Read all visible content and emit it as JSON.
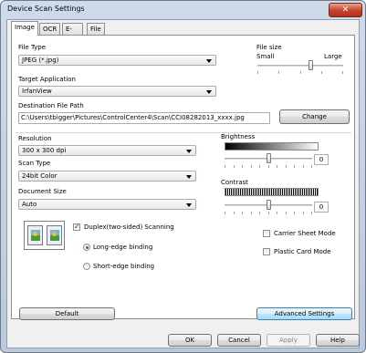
{
  "window": {
    "title": "Device Scan Settings",
    "close_glyph": "✕"
  },
  "tabs": [
    "Image",
    "OCR",
    "E-mail",
    "File"
  ],
  "file_type": {
    "label": "File Type",
    "value": "JPEG (*.jpg)"
  },
  "file_size": {
    "label": "File size",
    "min_label": "Small",
    "max_label": "Large",
    "level": 0.62
  },
  "target_application": {
    "label": "Target Application",
    "value": "IrfanView"
  },
  "destination": {
    "label": "Destination File Path",
    "value": "C:\\Users\\tbigger\\Pictures\\ControlCenter4\\Scan\\CCI08282013_xxxx.jpg",
    "change_label": "Change"
  },
  "resolution": {
    "label": "Resolution",
    "value": "300 x 300 dpi"
  },
  "scan_type": {
    "label": "Scan Type",
    "value": "24bit Color"
  },
  "document_size": {
    "label": "Document Size",
    "value": "Auto"
  },
  "brightness": {
    "label": "Brightness",
    "value": "0",
    "level": 0.5
  },
  "contrast": {
    "label": "Contrast",
    "value": "0",
    "level": 0.5
  },
  "duplex": {
    "label": "Duplex(two-sided) Scanning",
    "checked": true,
    "long_edge_label": "Long-edge binding",
    "short_edge_label": "Short-edge binding",
    "selected": "long"
  },
  "carrier_sheet": {
    "label": "Carrier Sheet Mode",
    "checked": false
  },
  "plastic_card": {
    "label": "Plastic Card Mode",
    "checked": false
  },
  "buttons": {
    "default": "Default",
    "advanced": "Advanced Settings",
    "ok": "OK",
    "cancel": "Cancel",
    "apply": "Apply",
    "help": "Help"
  },
  "colors": {
    "accent": "#3c7fb1",
    "close": "#c5412b",
    "frame": "#b9cade"
  }
}
